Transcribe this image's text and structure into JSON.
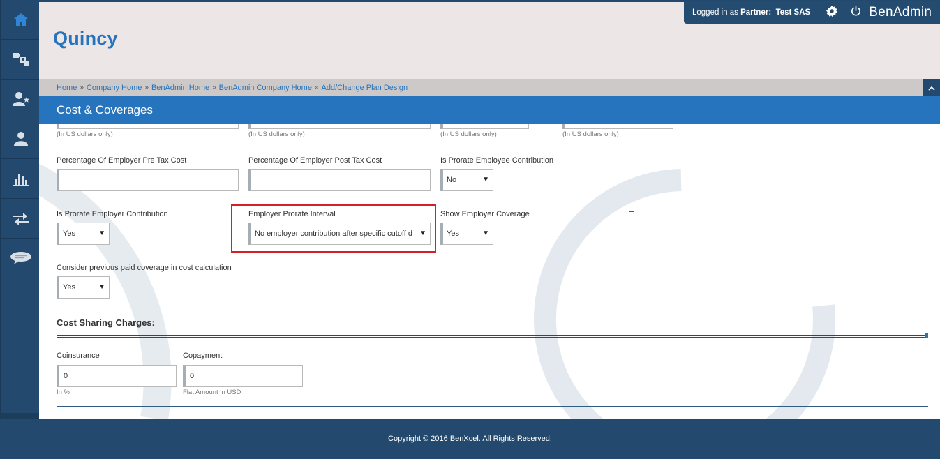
{
  "app": {
    "company_name": "Quincy",
    "brand": "BenAdmin"
  },
  "user": {
    "logged_prefix": "Logged in as ",
    "role_label": "Partner:",
    "name": "Test SAS"
  },
  "sidebar": {
    "items": [
      {
        "icon": "home-icon"
      },
      {
        "icon": "puzzle-icon"
      },
      {
        "icon": "user-star-icon"
      },
      {
        "icon": "user-icon"
      },
      {
        "icon": "bar-chart-icon"
      },
      {
        "icon": "transfer-arrows-icon"
      },
      {
        "icon": "chat-icon"
      }
    ]
  },
  "breadcrumb": {
    "items": [
      "Home",
      "Company Home",
      "BenAdmin Home",
      "BenAdmin Company Home",
      "Add/Change Plan Design"
    ],
    "separator": "»"
  },
  "section": {
    "title": "Cost & Coverages"
  },
  "form": {
    "usd_hint": "(In US dollars only)",
    "employer_pre_tax_pct": {
      "label": "Percentage Of Employer Pre Tax Cost",
      "value": ""
    },
    "employer_post_tax_pct": {
      "label": "Percentage Of Employer Post Tax Cost",
      "value": ""
    },
    "prorate_employee": {
      "label": "Is Prorate Employee Contribution",
      "value": "No"
    },
    "prorate_employer": {
      "label": "Is Prorate Employer Contribution",
      "value": "Yes"
    },
    "employer_prorate_interval": {
      "label": "Employer Prorate Interval",
      "value": "No employer contribution after specific cutoff date"
    },
    "show_employer_coverage": {
      "label": "Show Employer Coverage",
      "value": "Yes"
    },
    "previous_paid_coverage": {
      "label": "Consider previous paid coverage in cost calculation",
      "value": "Yes"
    },
    "cost_sharing_heading": "Cost Sharing Charges:",
    "coinsurance": {
      "label": "Coinsurance",
      "value": "0",
      "hint": "In %"
    },
    "copayment": {
      "label": "Copayment",
      "value": "0",
      "hint": "Flat Amount in USD"
    }
  },
  "footer": {
    "copyright": "Copyright © 2016 BenXcel. All Rights Reserved."
  },
  "colors": {
    "primary_blue": "#2574bd",
    "sidebar_navy": "#234a6e",
    "highlight_red": "#d1222a"
  }
}
